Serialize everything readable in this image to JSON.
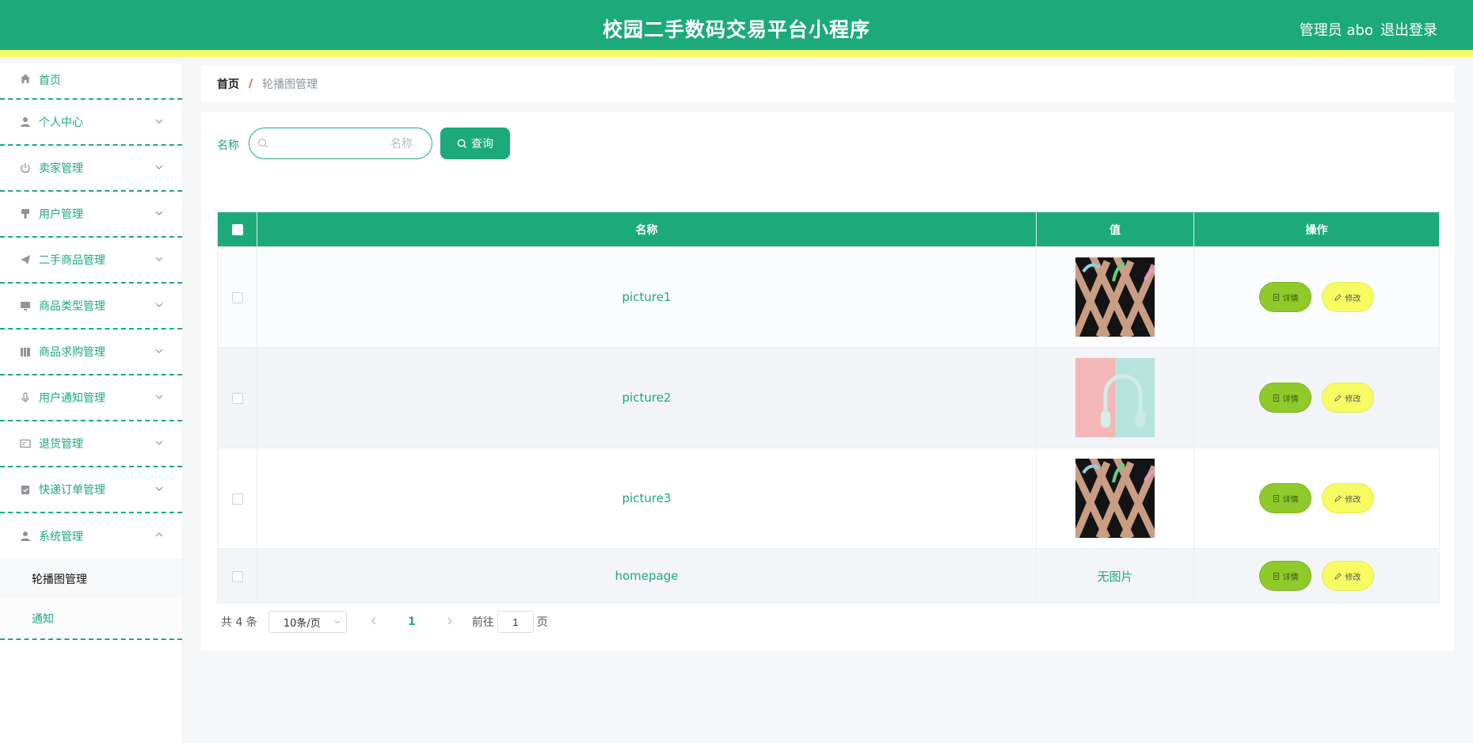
{
  "header": {
    "title": "校园二手数码交易平台小程序",
    "user": "管理员 abo",
    "logout": "退出登录"
  },
  "sidebar": {
    "items": [
      {
        "label": "首页",
        "icon": "home-icon"
      },
      {
        "label": "个人中心",
        "icon": "person-icon"
      },
      {
        "label": "卖家管理",
        "icon": "power-icon"
      },
      {
        "label": "用户管理",
        "icon": "brush-icon"
      },
      {
        "label": "二手商品管理",
        "icon": "paper-plane-icon"
      },
      {
        "label": "商品类型管理",
        "icon": "monitor-icon"
      },
      {
        "label": "商品求购管理",
        "icon": "books-icon"
      },
      {
        "label": "用户通知管理",
        "icon": "microphone-icon"
      },
      {
        "label": "退货管理",
        "icon": "id-card-icon"
      },
      {
        "label": "快递订单管理",
        "icon": "clipboard-check-icon"
      },
      {
        "label": "系统管理",
        "icon": "user-cog-icon"
      }
    ],
    "sub_items": [
      {
        "label": "轮播图管理",
        "active": true
      },
      {
        "label": "通知",
        "active": false
      }
    ]
  },
  "breadcrumb": {
    "home": "首页",
    "separator": "/",
    "current": "轮播图管理"
  },
  "search": {
    "label": "名称",
    "placeholder": "名称",
    "button": "查询"
  },
  "table": {
    "headers": [
      "名称",
      "值",
      "操作"
    ],
    "rows": [
      {
        "name": "picture1",
        "value": "image",
        "image": "pattern"
      },
      {
        "name": "picture2",
        "value": "image",
        "image": "headphones"
      },
      {
        "name": "picture3",
        "value": "image",
        "image": "pattern"
      },
      {
        "name": "homepage",
        "value": "无图片",
        "image": "none"
      }
    ],
    "detail_label": "详情",
    "edit_label": "修改"
  },
  "pagination": {
    "total": "共 4 条",
    "page_size": "10条/页",
    "current_page": "1",
    "goto_label": "前往",
    "goto_value": "1",
    "page_suffix": "页"
  },
  "colors": {
    "primary": "#1caa7a",
    "accent_yellow": "#f5fd67",
    "detail_green": "#8fc92a",
    "edit_yellow": "#f7fb62"
  }
}
